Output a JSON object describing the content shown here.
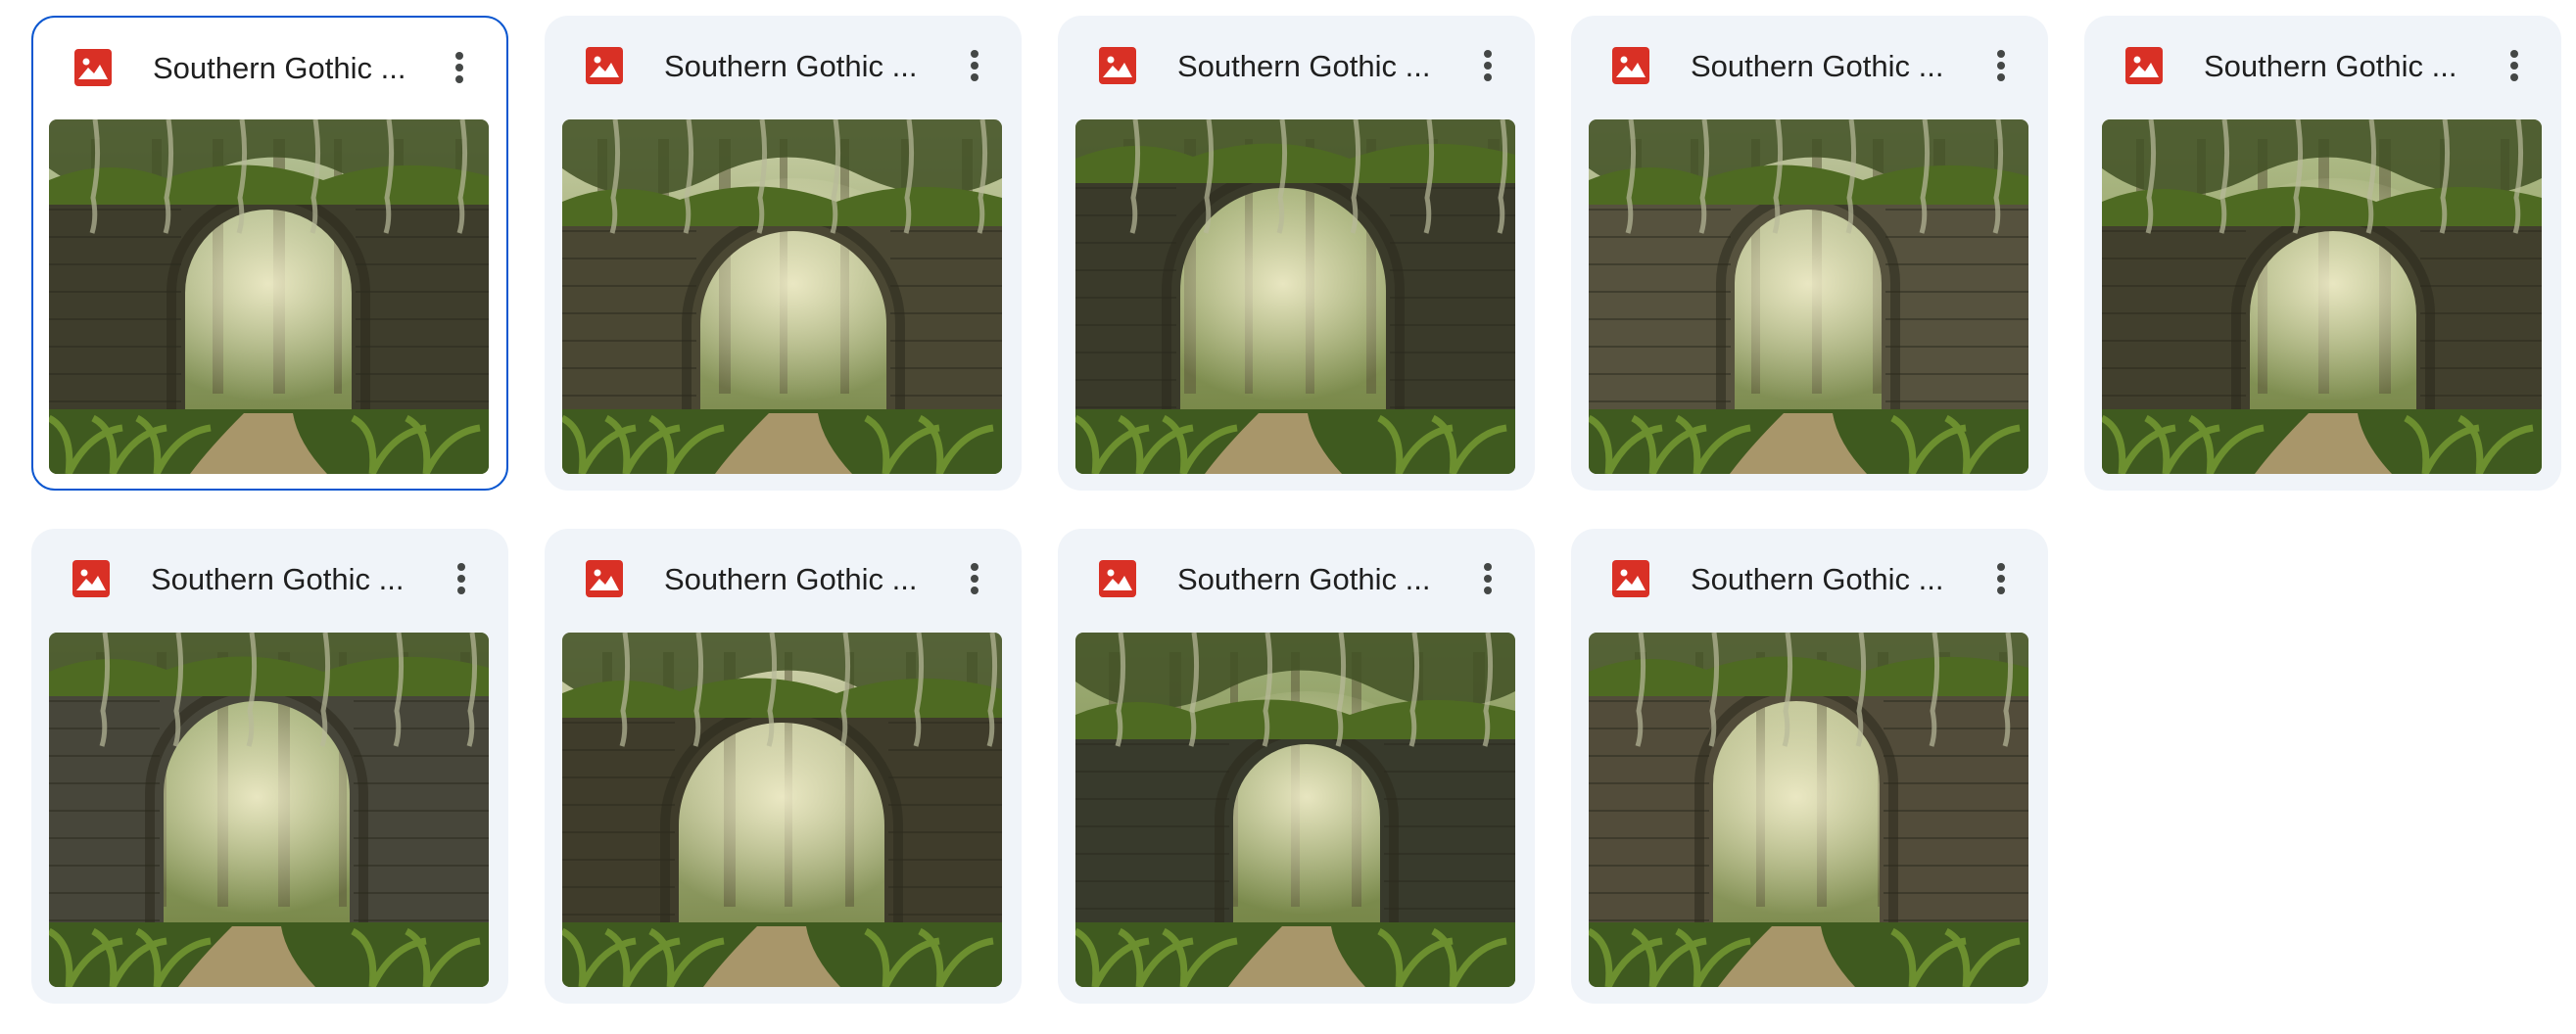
{
  "files": [
    {
      "name": "Southern Gothic ...",
      "selected": true,
      "icon": "image-file-icon",
      "variant": 1
    },
    {
      "name": "Southern Gothic ...",
      "selected": false,
      "icon": "image-file-icon",
      "variant": 2
    },
    {
      "name": "Southern Gothic ...",
      "selected": false,
      "icon": "image-file-icon",
      "variant": 3
    },
    {
      "name": "Southern Gothic ...",
      "selected": false,
      "icon": "image-file-icon",
      "variant": 4
    },
    {
      "name": "Southern Gothic ...",
      "selected": false,
      "icon": "image-file-icon",
      "variant": 5
    },
    {
      "name": "Southern Gothic ...",
      "selected": false,
      "icon": "image-file-icon",
      "variant": 6
    },
    {
      "name": "Southern Gothic ...",
      "selected": false,
      "icon": "image-file-icon",
      "variant": 7
    },
    {
      "name": "Southern Gothic ...",
      "selected": false,
      "icon": "image-file-icon",
      "variant": 8
    },
    {
      "name": "Southern Gothic ...",
      "selected": false,
      "icon": "image-file-icon",
      "variant": 9
    }
  ],
  "colors": {
    "card_background": "#f0f4f9",
    "selected_border": "#0b57d0",
    "file_icon": "#d93025",
    "text": "#1f1f1f",
    "more_icon": "#444746"
  }
}
